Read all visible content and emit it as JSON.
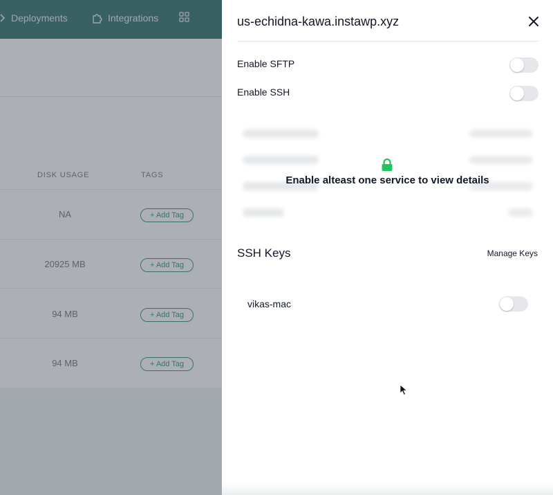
{
  "background": {
    "nav": {
      "deployments_label": "Deployments",
      "integrations_label": "Integrations",
      "deploy_icon": "chevron-right-icon",
      "integrations_icon": "puzzle-icon",
      "apps_icon": "grid-icon"
    },
    "table": {
      "headers": [
        "DISK USAGE",
        "TAGS"
      ],
      "rows": [
        {
          "disk_usage": "NA",
          "tag_button": "+ Add Tag"
        },
        {
          "disk_usage": "20925 MB",
          "tag_button": "+ Add Tag"
        },
        {
          "disk_usage": "94 MB",
          "tag_button": "+ Add Tag"
        },
        {
          "disk_usage": "94 MB",
          "tag_button": "+ Add Tag"
        }
      ]
    }
  },
  "panel": {
    "title": "us-echidna-kawa.instawp.xyz",
    "close_icon": "close-icon",
    "settings": [
      {
        "label": "Enable SFTP",
        "enabled": false
      },
      {
        "label": "Enable SSH",
        "enabled": false
      }
    ],
    "locked": {
      "icon": "lock-icon",
      "icon_color": "#22c55e",
      "message": "Enable alteast one service to view details"
    },
    "ssh_keys": {
      "title": "SSH Keys",
      "manage_label": "Manage Keys",
      "keys": [
        {
          "name": "vikas-mac",
          "enabled": false
        }
      ]
    }
  },
  "colors": {
    "brand_nav": "#2f6f6a",
    "tag_accent": "#2f8f7a",
    "lock_green": "#22c55e",
    "toggle_off": "#e5e7eb"
  }
}
